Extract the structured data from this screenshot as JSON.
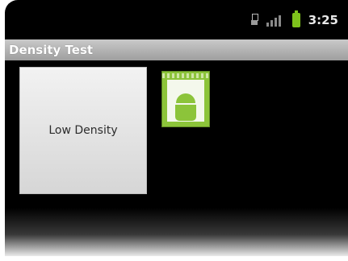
{
  "status_bar": {
    "time": "3:25",
    "icons": [
      "usb-icon",
      "signal-icon",
      "battery-icon"
    ],
    "battery_color": "#7ec21c"
  },
  "app": {
    "title": "Density Test"
  },
  "main": {
    "button_label": "Low Density",
    "image_icon": "android-icon"
  }
}
